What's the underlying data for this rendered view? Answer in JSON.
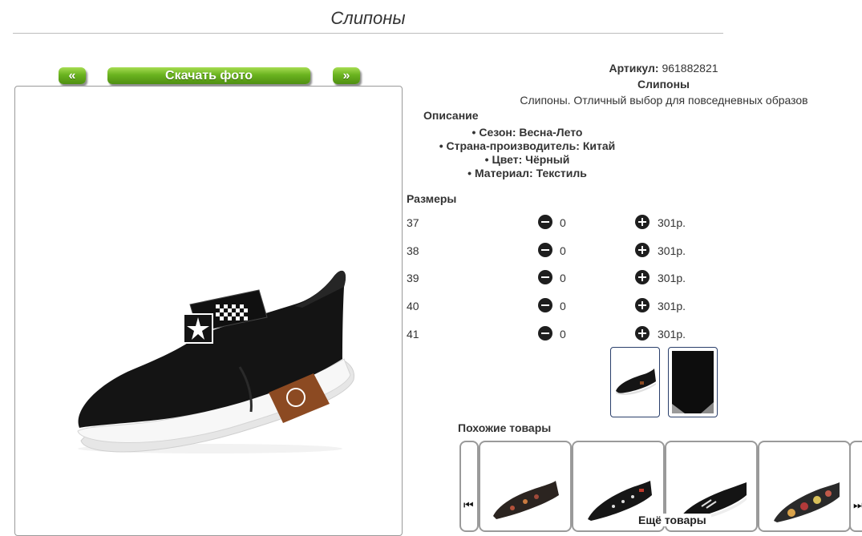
{
  "page": {
    "title": "Слипоны"
  },
  "photo_nav": {
    "prev_label": "«",
    "download_label": "Скачать фото",
    "next_label": "»"
  },
  "product": {
    "article_label": "Артикул:",
    "article_value": "961882821",
    "name": "Слипоны",
    "description": "Слипоны. Отличный выбор для повседневных образов"
  },
  "description_section": {
    "heading": "Описание",
    "features": [
      "Сезон: Весна-Лето",
      "Страна-производитель: Китай",
      "Цвет: Чёрный",
      "Материал: Текстиль"
    ]
  },
  "sizes_section": {
    "heading": "Размеры",
    "rows": [
      {
        "size": "37",
        "qty": "0",
        "price": "301р."
      },
      {
        "size": "38",
        "qty": "0",
        "price": "301р."
      },
      {
        "size": "39",
        "qty": "0",
        "price": "301р."
      },
      {
        "size": "40",
        "qty": "0",
        "price": "301р."
      },
      {
        "size": "41",
        "qty": "0",
        "price": "301р."
      }
    ]
  },
  "similar": {
    "heading": "Похожие товары",
    "prev_icon": "skip-back-icon",
    "next_icon": "skip-forward-icon",
    "more_label": "Ещё товары"
  },
  "colors": {
    "button_green": "#6ab31f",
    "thumb_border": "#2a3f6b"
  }
}
